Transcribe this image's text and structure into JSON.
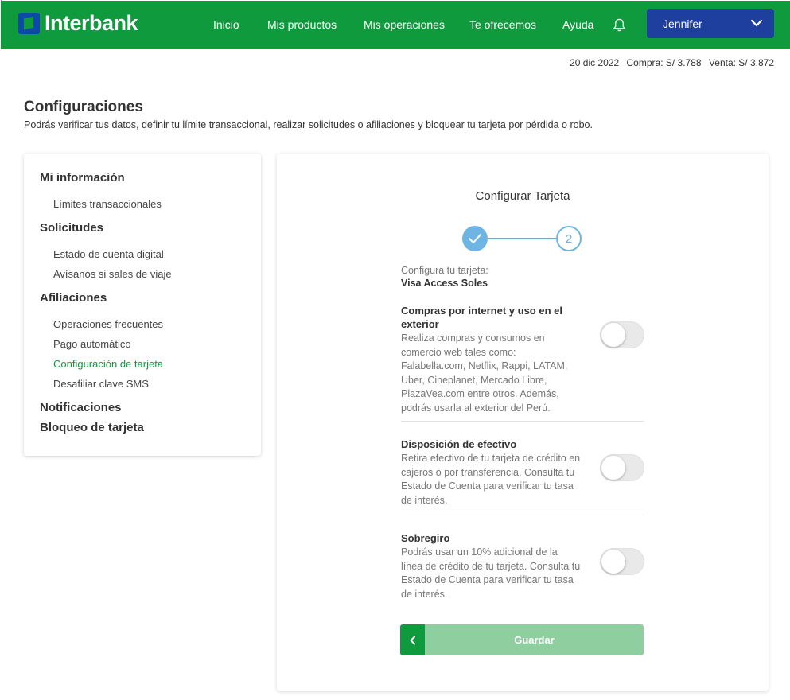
{
  "header": {
    "brand": "Interbank",
    "nav": [
      "Inicio",
      "Mis productos",
      "Mis operaciones",
      "Te ofrecemos",
      "Ayuda"
    ],
    "user_name": "Jennifer"
  },
  "rates": {
    "date": "20 dic 2022",
    "buy": "Compra: S/ 3.788",
    "sell": "Venta: S/ 3.872"
  },
  "page": {
    "title": "Configuraciones",
    "subtitle": "Podrás verificar tus datos, definir tu límite transaccional, realizar solicitudes o afiliaciones y bloquear tu tarjeta por pérdida o robo."
  },
  "sidebar": {
    "sections": [
      {
        "title": "Mi información",
        "items": [
          "Límites transaccionales"
        ]
      },
      {
        "title": "Solicitudes",
        "items": [
          "Estado de cuenta digital",
          "Avísanos si sales de viaje"
        ]
      },
      {
        "title": "Afiliaciones",
        "items": [
          "Operaciones frecuentes",
          "Pago automático",
          "Configuración de tarjeta",
          "Desafiliar clave SMS"
        ]
      },
      {
        "title": "Notificaciones",
        "items": []
      },
      {
        "title": "Bloqueo de tarjeta",
        "items": []
      }
    ],
    "active_item": "Configuración de tarjeta"
  },
  "panel": {
    "title": "Configurar Tarjeta",
    "step2_label": "2",
    "card_label": "Configura tu tarjeta:",
    "card_name": "Visa Access Soles",
    "options": [
      {
        "title": "Compras por internet y uso en el exterior",
        "description": "Realiza compras y consumos en comercio web tales como: Falabella.com, Netflix, Rappi, LATAM, Uber, Cineplanet, Mercado Libre, PlazaVea.com entre otros. Además, podrás usarla al exterior del Perú.",
        "enabled": false
      },
      {
        "title": "Disposición de efectivo",
        "description": "Retira efectivo de tu tarjeta de crédito en cajeros o por transferencia. Consulta tu Estado de Cuenta para verificar tu tasa de interés.",
        "enabled": false
      },
      {
        "title": "Sobregiro",
        "description": "Podrás usar un 10% adicional de la línea de crédito de tu tarjeta. Consulta tu Estado de Cuenta para verificar tu tasa de interés.",
        "enabled": false
      }
    ],
    "save_label": "Guardar"
  },
  "colors": {
    "brand_green": "#0f9a3e",
    "brand_blue": "#1f3f9e",
    "step_blue": "#6fb5e3",
    "save_disabled": "#8fce9f"
  }
}
